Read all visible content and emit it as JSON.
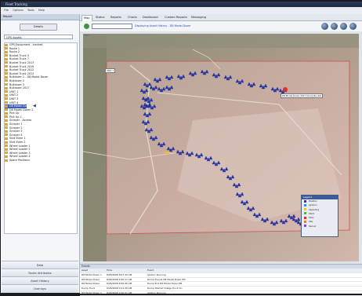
{
  "window": {
    "title": "Fleet Tracking"
  },
  "menu": [
    "File",
    "Options",
    "Tools",
    "Help"
  ],
  "sidebar": {
    "header": "Report",
    "button": "Details",
    "select_value": "GPS Assets",
    "tree": [
      "GPS Equipment - tracked",
      "Route 1",
      "Route 2",
      "Bucket Truck 3",
      "Bucket Truck 7",
      "Bucket Truck 2017",
      "Bucket Truck 2019",
      "Bucket Truck 2012",
      "Bucket Truck 2013",
      "Bulldozer 1 - D8 Model Dozer",
      "Bulldozer 2",
      "Bulldozer 3",
      "Bulldozer 2017",
      "UNIT 1",
      "UNIT 2",
      "UNIT 3",
      "UNIT 4",
      "D8 Model Dozer",
      "D8 Model Dozer 2",
      "Pick Up",
      "Pick Up 2",
      "Scraper - Access",
      "Scraper 1",
      "Scraper 2",
      "Scraper 3",
      "Scraper 4",
      "Skid Steer 1",
      "Skid Steer 2",
      "Wheel Loader 1",
      "Wheel Loader 2",
      "Wheel Loader 3",
      "Wheel Loader 4",
      "Spare Positions"
    ],
    "selected_index": 17,
    "nav": [
      "Data",
      "Route Attributes",
      "Asset History",
      "Overlays"
    ]
  },
  "tabs": [
    "Map",
    "Status",
    "Reports",
    "Charts",
    "Dashboard",
    "Custom Reports",
    "Messaging"
  ],
  "active_tab": 0,
  "toolbar": {
    "field_value": "",
    "status_text": "Displaying Asset History - D8 Model Dozer"
  },
  "map": {
    "coord_readout": "",
    "markers": [
      {
        "label": "UNIT 7"
      },
      {
        "label": "D8 Model Dozer 2017 Dump Bucket"
      }
    ],
    "legend": {
      "title": "Legend",
      "items": [
        {
          "label": "Position",
          "color": "#2439b8"
        },
        {
          "label": "Ignition",
          "color": "#3a8de0"
        },
        {
          "label": "Speeding",
          "color": "#f0c020"
        },
        {
          "label": "Start",
          "color": "#44bb44"
        },
        {
          "label": "Stop",
          "color": "#dd3030"
        },
        {
          "label": "Idle",
          "color": "#d58a2a"
        },
        {
          "label": "Sensor",
          "color": "#8844cc"
        }
      ]
    }
  },
  "events": {
    "title": "Events",
    "columns": [
      "Asset",
      "Time",
      "Event"
    ],
    "rows": [
      [
        "D8 Model Dozer 1",
        "8/26/2008 8:07:20 AM",
        "Ignition Running"
      ],
      [
        "D8 Model Dozer",
        "8/26/2008 8:40:37 AM",
        "Dump Events D8 Model Dozer PM"
      ],
      [
        "D8 Model Dozer",
        "8/26/2008 8:50:45 AM",
        "Dump End D8 Model Dozer PM"
      ],
      [
        "Dump Truck",
        "8/26/2008 9:11:20 AM",
        "Dump Started Village Truck On"
      ],
      [
        "D8 Model Dozer 3",
        "8/26/2008 9:20:01 AM",
        "Ignition Running"
      ]
    ]
  }
}
